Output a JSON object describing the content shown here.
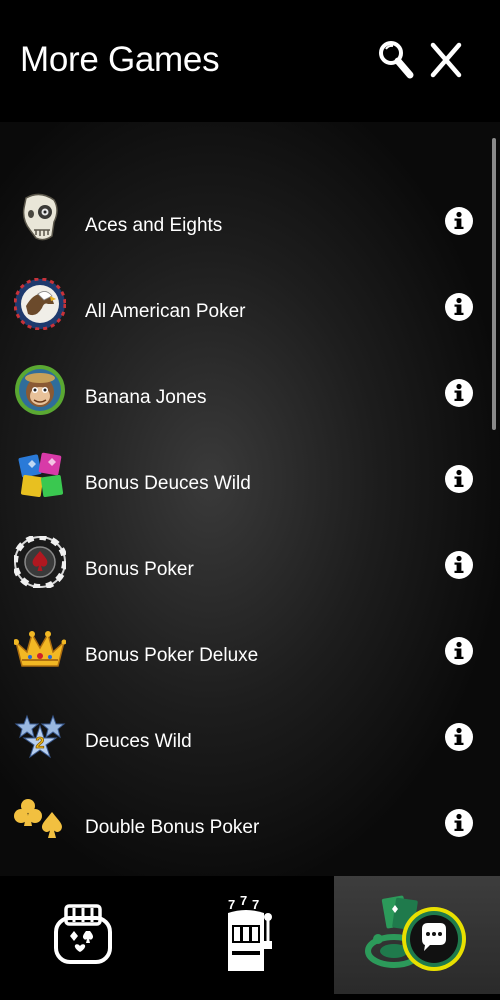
{
  "header": {
    "title": "More Games",
    "search_icon": "search-icon",
    "close_icon": "close-icon"
  },
  "games": [
    {
      "name": "Aces and Eights",
      "icon": "skull-icon"
    },
    {
      "name": "All American Poker",
      "icon": "eagle-icon"
    },
    {
      "name": "Banana Jones",
      "icon": "monkey-icon"
    },
    {
      "name": "Bonus Deuces Wild",
      "icon": "colored-cards-icon"
    },
    {
      "name": "Bonus Poker",
      "icon": "poker-chip-icon"
    },
    {
      "name": "Bonus Poker Deluxe",
      "icon": "crown-icon"
    },
    {
      "name": "Deuces Wild",
      "icon": "stars-deuce-icon"
    },
    {
      "name": "Double Bonus Poker",
      "icon": "club-spade-icon"
    }
  ],
  "tabs": [
    {
      "icon": "video-poker-icon"
    },
    {
      "icon": "slot-machine-icon"
    },
    {
      "icon": "table-games-chat-icon",
      "selected": true
    }
  ],
  "colors": {
    "background": "#000000",
    "selected_tab": "#3a3a3a",
    "chat_badge": "#1f7a4c",
    "chat_ring": "#e8e000"
  }
}
